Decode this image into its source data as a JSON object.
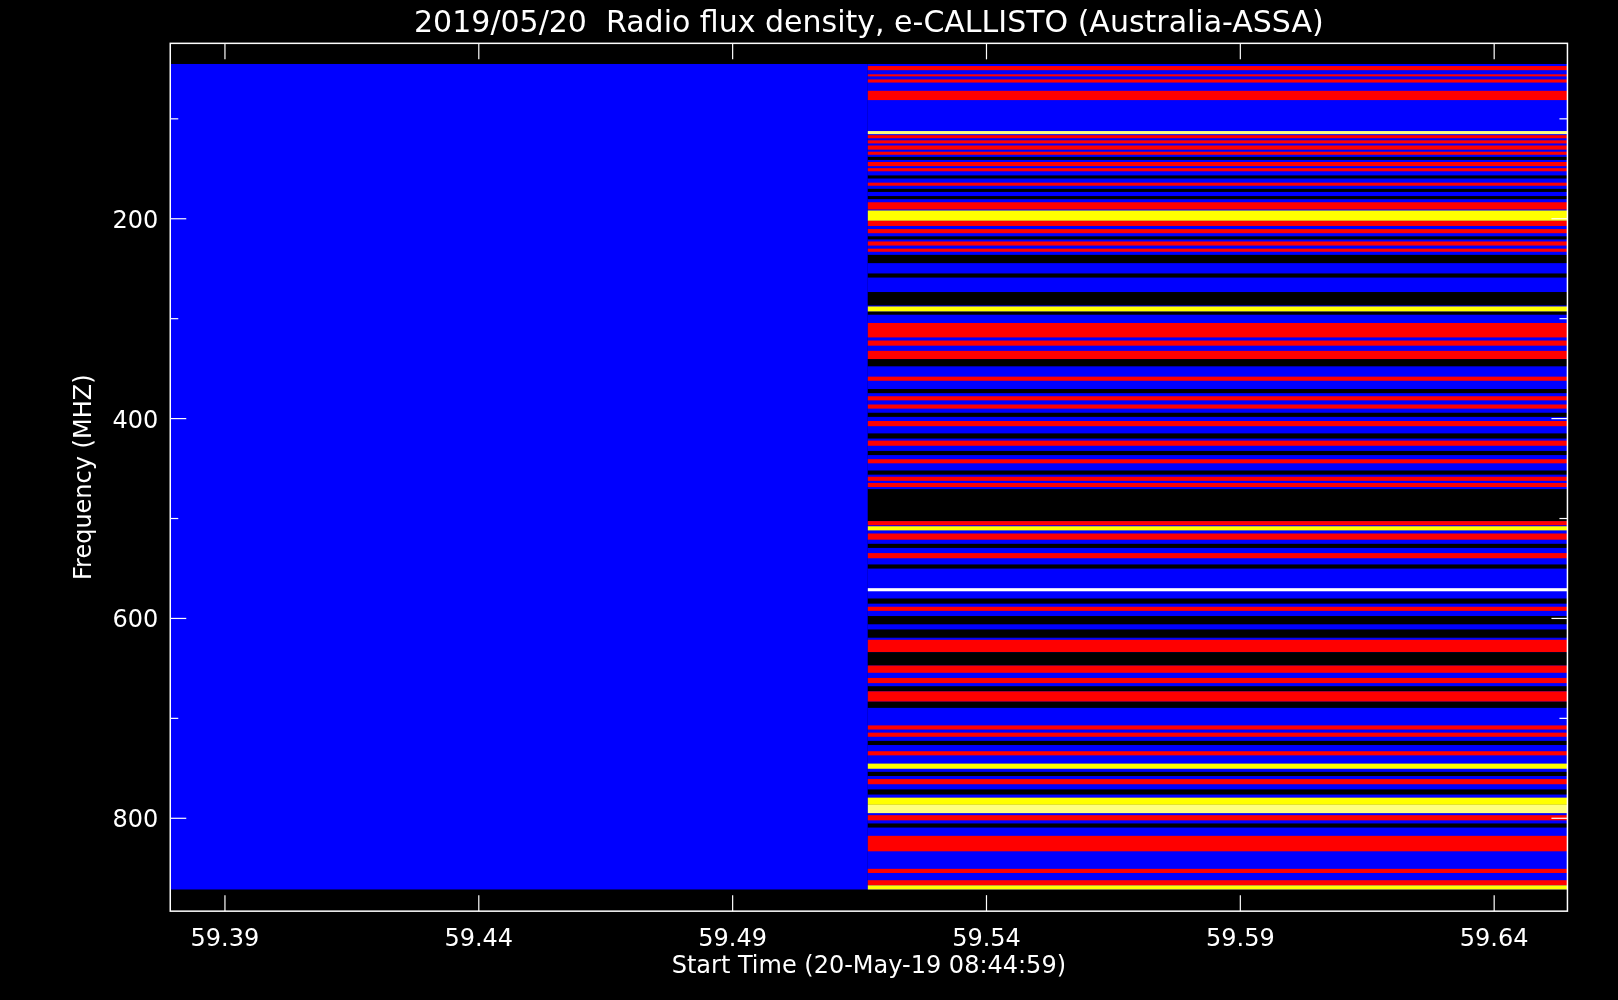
{
  "title": "2019/05/20  Radio flux density, e-CALLISTO (Australia-ASSA)",
  "plot": {
    "ylabel": "Frequency (MHZ)",
    "xlabel": "Start Time (20-May-19 08:44:59)",
    "yticks": [
      "200",
      "400",
      "600",
      "800"
    ],
    "xticks": [
      "59.39",
      "59.44",
      "59.49",
      "59.54",
      "59.59",
      "59.64"
    ]
  }
}
